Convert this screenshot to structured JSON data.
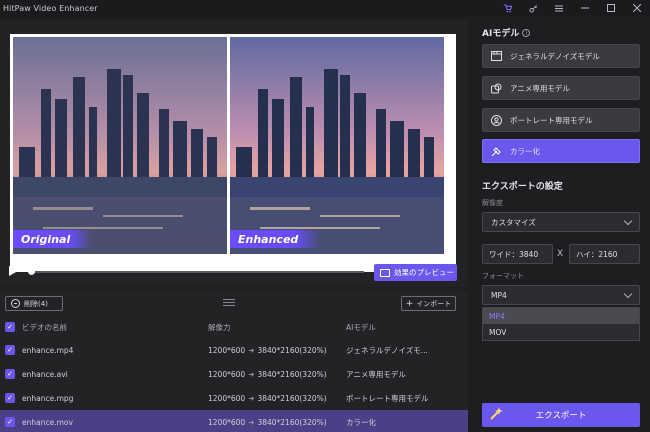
{
  "titlebar": {
    "app_title": "HitPaw Video Enhancer",
    "icons": [
      "cart-icon",
      "key-icon",
      "menu-icon",
      "minimize-icon",
      "maximize-icon",
      "close-icon"
    ]
  },
  "preview": {
    "left_tag": "Original",
    "right_tag": "Enhanced",
    "preview_button": "効果のプレビュー",
    "playback_progress": 0
  },
  "list": {
    "delete_button": "削除(4)",
    "import_button": "インポート",
    "columns": {
      "name": "ビデオの名前",
      "resolution": "解像力",
      "model": "AIモデル"
    },
    "rows": [
      {
        "name": "enhance.mp4",
        "from": "1200*600",
        "to": "3840*2160(320%)",
        "model": "ジェネラルデノイズモ...",
        "checked": true,
        "selected": false
      },
      {
        "name": "enhance.avi",
        "from": "1200*600",
        "to": "3840*2160(320%)",
        "model": "アニメ専用モデル",
        "checked": true,
        "selected": false
      },
      {
        "name": "enhance.mpg",
        "from": "1200*600",
        "to": "3840*2160(320%)",
        "model": "ポートレート専用モデル",
        "checked": true,
        "selected": false
      },
      {
        "name": "enhance.mov",
        "from": "1200*600",
        "to": "3840*2160(320%)",
        "model": "カラー化",
        "checked": true,
        "selected": true
      }
    ]
  },
  "right": {
    "ai_model_title": "AIモデル",
    "models": [
      {
        "label": "ジェネラルデノイズモデル",
        "icon": "film-icon",
        "active": false
      },
      {
        "label": "アニメ専用モデル",
        "icon": "anime-icon",
        "active": false
      },
      {
        "label": "ポートレート専用モデル",
        "icon": "portrait-icon",
        "active": false
      },
      {
        "label": "カラー化",
        "icon": "colorize-icon",
        "active": true
      }
    ],
    "export_title": "エクスポートの設定",
    "resolution_label": "解像度",
    "resolution_value": "カスタマイズ",
    "width_field": "ワイド：3840",
    "height_field": "ハイ：2160",
    "x_separator": "X",
    "format_label": "フォーマット",
    "format_value": "MP4",
    "format_options": [
      "MP4",
      "MOV"
    ],
    "export_button": "エクスポート",
    "accent": "#6a58ee"
  }
}
